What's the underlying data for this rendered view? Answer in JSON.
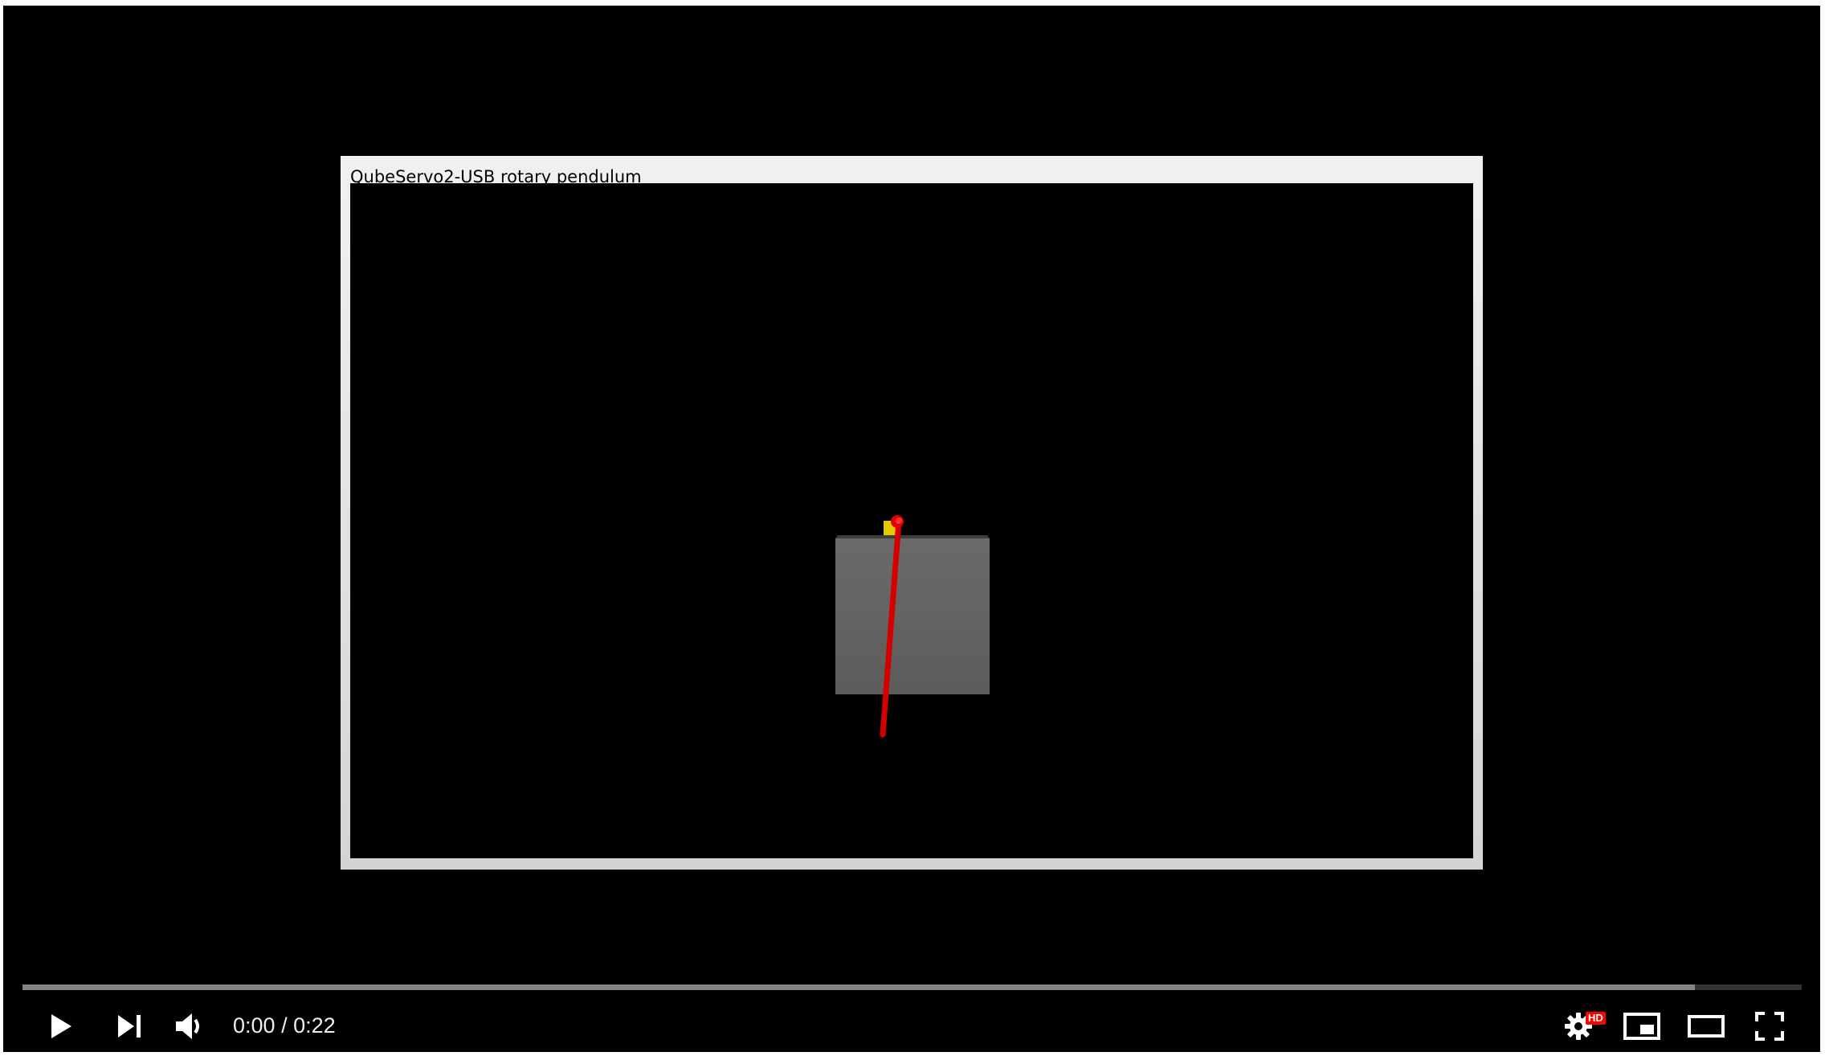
{
  "simulation": {
    "window_title": "QubeServo2-USB rotary pendulum",
    "colors": {
      "window_frame": "#e6e6e6",
      "background": "#000000",
      "base_body": "#646464",
      "pendulum": "#e00000",
      "arm_hub": "#e6c800"
    }
  },
  "player": {
    "current_time": "0:00",
    "time_separator": "/",
    "duration": "0:22",
    "progress_played_fraction": 0,
    "progress_loaded_fraction": 0.94,
    "hd_badge": "HD",
    "icons": {
      "play": "play-icon",
      "next": "next-icon",
      "volume": "volume-icon",
      "settings": "gear-icon",
      "miniplayer": "miniplayer-icon",
      "theater": "theater-mode-icon",
      "fullscreen": "fullscreen-icon"
    },
    "colors": {
      "accent": "#ff0000",
      "icon": "#ffffff"
    }
  }
}
